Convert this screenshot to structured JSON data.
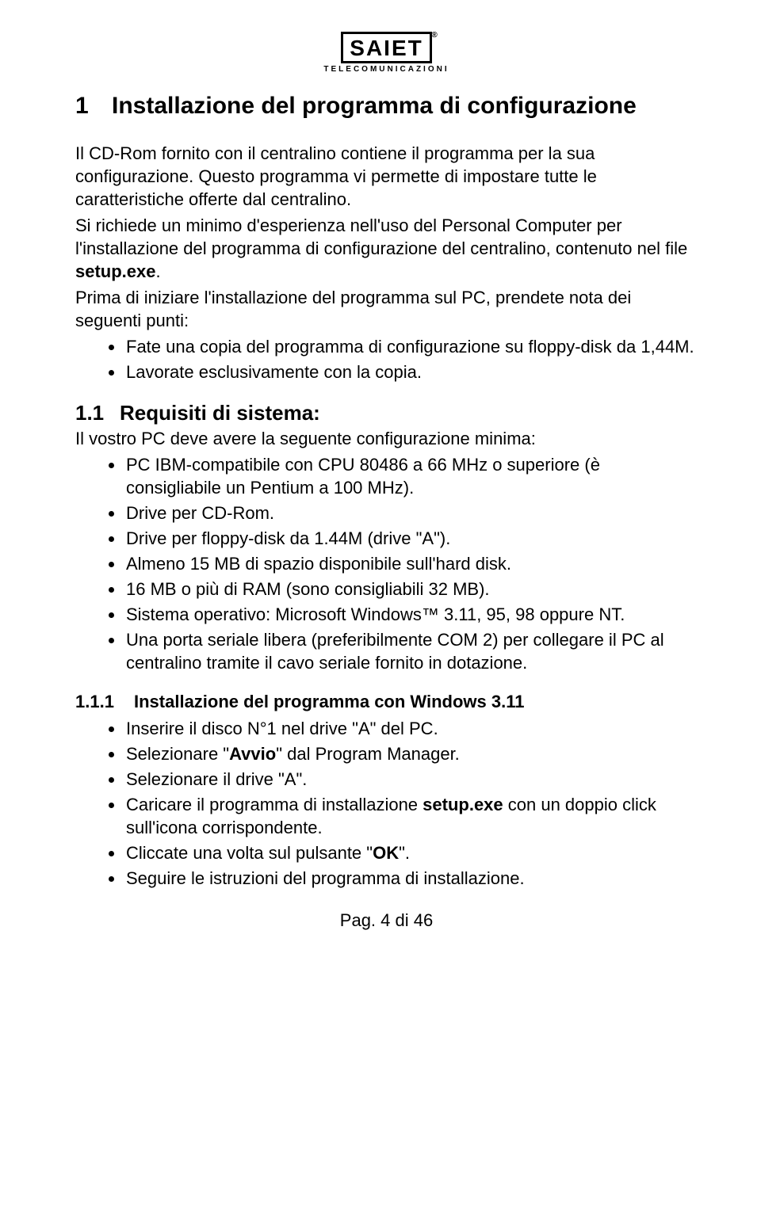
{
  "logo": {
    "text": "SAIET",
    "reg": "®",
    "sub": "TELECOMUNICAZIONI"
  },
  "h1": {
    "num": "1",
    "title": "Installazione del programma di configurazione"
  },
  "intro": {
    "p1a": "Il CD-Rom fornito con il centralino  contiene il programma per la sua configurazione. Questo programma vi permette di impostare tutte le caratteristiche offerte dal centralino.",
    "p2a": "Si richiede un minimo d'esperienza nell'uso del Personal Computer per l'installazione del programma di configurazione del centralino, contenuto nel file ",
    "p2strong": "setup.exe",
    "p2b": ".",
    "p3": "Prima di iniziare l'installazione del programma sul PC, prendete nota dei seguenti punti:"
  },
  "introList": [
    "Fate una copia del programma di configurazione su floppy-disk da 1,44M.",
    "Lavorate esclusivamente con la copia."
  ],
  "h2": {
    "num": "1.1",
    "title": "Requisiti di sistema:"
  },
  "reqLead": "Il vostro PC deve avere la seguente configurazione minima:",
  "reqList": [
    "PC IBM-compatibile con CPU 80486 a 66 MHz o superiore (è consigliabile un Pentium a 100 MHz).",
    "Drive per CD-Rom.",
    "Drive per floppy-disk da 1.44M (drive \"A\").",
    "Almeno 15 MB di spazio disponibile sull'hard disk.",
    "16 MB o più di RAM (sono consigliabili 32 MB).",
    "Sistema operativo: Microsoft Windows™ 3.11, 95, 98 oppure NT.",
    "Una porta seriale libera (preferibilmente COM 2) per collegare il PC al centralino tramite il cavo seriale fornito in dotazione."
  ],
  "h3": {
    "num": "1.1.1",
    "title": "Installazione del programma con Windows 3.11"
  },
  "steps": {
    "s0": "Inserire il disco N°1  nel drive \"A\" del PC.",
    "s1a": "Selezionare \"",
    "s1strong": "Avvio",
    "s1b": "\" dal Program Manager.",
    "s2": "Selezionare il drive \"A\".",
    "s3a": "Caricare il programma di installazione ",
    "s3strong": "setup.exe",
    "s3b": " con un doppio click sull'icona corrispondente.",
    "s4a": "Cliccate una volta sul pulsante \"",
    "s4strong": "OK",
    "s4b": "\".",
    "s5": "Seguire le istruzioni del programma di installazione."
  },
  "footer": "Pag. 4 di 46"
}
